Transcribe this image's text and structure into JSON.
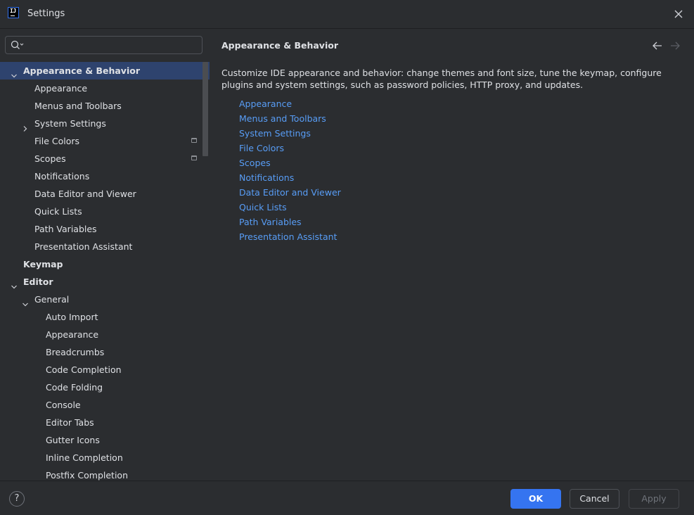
{
  "window": {
    "title": "Settings",
    "app_icon_text": "IJ"
  },
  "search": {
    "placeholder": "",
    "value": ""
  },
  "tree": [
    {
      "label": "Appearance & Behavior",
      "level": 0,
      "expanded": true,
      "selected": true,
      "bold": true
    },
    {
      "label": "Appearance",
      "level": 1
    },
    {
      "label": "Menus and Toolbars",
      "level": 1
    },
    {
      "label": "System Settings",
      "level": 1,
      "collapsed": true
    },
    {
      "label": "File Colors",
      "level": 1,
      "badge": true
    },
    {
      "label": "Scopes",
      "level": 1,
      "badge": true
    },
    {
      "label": "Notifications",
      "level": 1
    },
    {
      "label": "Data Editor and Viewer",
      "level": 1
    },
    {
      "label": "Quick Lists",
      "level": 1
    },
    {
      "label": "Path Variables",
      "level": 1
    },
    {
      "label": "Presentation Assistant",
      "level": 1
    },
    {
      "label": "Keymap",
      "level": 0,
      "bold": true
    },
    {
      "label": "Editor",
      "level": 0,
      "expanded": true,
      "bold": true
    },
    {
      "label": "General",
      "level": 1,
      "expanded": true
    },
    {
      "label": "Auto Import",
      "level": 2
    },
    {
      "label": "Appearance",
      "level": 2
    },
    {
      "label": "Breadcrumbs",
      "level": 2
    },
    {
      "label": "Code Completion",
      "level": 2
    },
    {
      "label": "Code Folding",
      "level": 2
    },
    {
      "label": "Console",
      "level": 2
    },
    {
      "label": "Editor Tabs",
      "level": 2
    },
    {
      "label": "Gutter Icons",
      "level": 2
    },
    {
      "label": "Inline Completion",
      "level": 2
    },
    {
      "label": "Postfix Completion",
      "level": 2
    }
  ],
  "content": {
    "title": "Appearance & Behavior",
    "description": "Customize IDE appearance and behavior: change themes and font size, tune the keymap, configure plugins and system settings, such as password policies, HTTP proxy, and updates.",
    "links": [
      "Appearance",
      "Menus and Toolbars",
      "System Settings",
      "File Colors",
      "Scopes",
      "Notifications",
      "Data Editor and Viewer",
      "Quick Lists",
      "Path Variables",
      "Presentation Assistant"
    ]
  },
  "footer": {
    "help": "?",
    "ok": "OK",
    "cancel": "Cancel",
    "apply": "Apply"
  },
  "colors": {
    "accent": "#3574f0",
    "link": "#589df6",
    "selection": "#2e436e",
    "background": "#2b2d30"
  },
  "icons": [
    "search-icon",
    "close-icon",
    "chevron-down-icon",
    "chevron-right-icon",
    "arrow-left-icon",
    "arrow-right-icon",
    "help-icon"
  ]
}
